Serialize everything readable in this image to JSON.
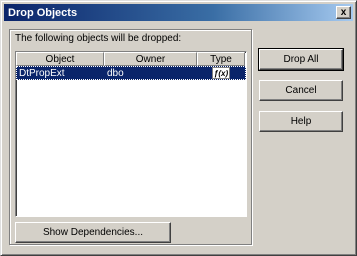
{
  "window": {
    "title": "Drop Objects",
    "close_glyph": "x"
  },
  "group": {
    "caption": "The following objects will be dropped:"
  },
  "list": {
    "columns": [
      "Object",
      "Owner",
      "Type"
    ],
    "rows": [
      {
        "object": "DtPropExt",
        "owner": "dbo",
        "type_icon": "function-icon",
        "type_glyph": "ƒ(x)"
      }
    ],
    "selected_row": 0
  },
  "buttons": {
    "drop_all": "Drop All",
    "cancel": "Cancel",
    "help": "Help",
    "show_dependencies": "Show Dependencies..."
  },
  "colors": {
    "title_start": "#0a246a",
    "title_end": "#a6caf0",
    "selection": "#0a246a",
    "face": "#d4d0c8"
  }
}
